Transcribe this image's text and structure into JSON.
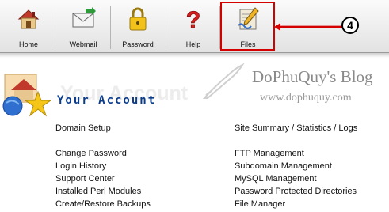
{
  "toolbar": {
    "home": "Home",
    "webmail": "Webmail",
    "password": "Password",
    "help": "Help",
    "files": "Files"
  },
  "annotation": {
    "step": "4"
  },
  "watermark": {
    "blog_title": "DoPhuQuy's Blog",
    "blog_url": "www.dophuquy.com"
  },
  "account": {
    "title": "Your Account"
  },
  "left_links": [
    "Domain Setup",
    "Change Password",
    "Login History",
    "Support Center",
    "Installed Perl Modules",
    "Create/Restore Backups"
  ],
  "right_links": [
    "Site Summary / Statistics / Logs",
    "FTP Management",
    "Subdomain Management",
    "MySQL Management",
    "Password Protected Directories",
    "File Manager"
  ],
  "colors": {
    "accent": "#0a3c8c",
    "highlight": "#d40000"
  }
}
